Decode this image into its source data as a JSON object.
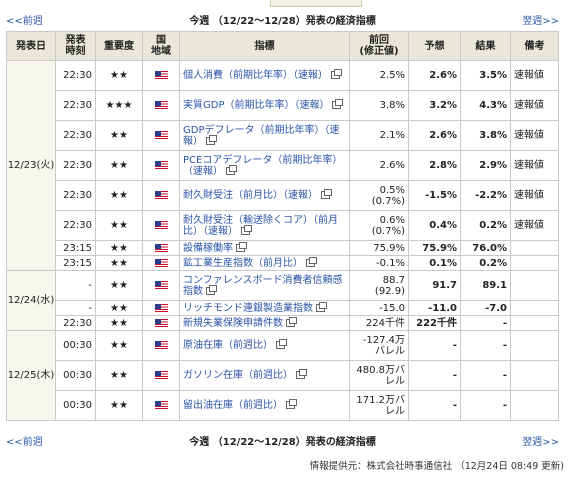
{
  "nav": {
    "prev": "<<前週",
    "title": "今週 （12/22～12/28）発表の経済指標",
    "next": "翌週>>"
  },
  "table": {
    "headers": [
      "発表日",
      "発表\n時刻",
      "重要度",
      "国\n地域",
      "指標",
      "前回\n(修正値)",
      "予想",
      "結果",
      "備考"
    ],
    "rows": [
      {
        "date": "12/23(火)",
        "time": "22:30",
        "importance": "★★",
        "indicator": "個人消費（前期比年率）（速報）",
        "previous": "2.5%",
        "forecast": "2.6%",
        "result": "3.5%",
        "note": "速報値"
      },
      {
        "time": "22:30",
        "importance": "★★★",
        "indicator": "実質GDP（前期比年率）（速報）",
        "previous": "3.8%",
        "forecast": "3.2%",
        "result": "4.3%",
        "note": "速報値"
      },
      {
        "time": "22:30",
        "importance": "★★",
        "indicator": "GDPデフレータ（前期比年率）（速報）",
        "previous": "2.1%",
        "forecast": "2.6%",
        "result": "3.8%",
        "note": "速報値"
      },
      {
        "time": "22:30",
        "importance": "★★",
        "indicator": "PCEコアデフレータ（前期比年率）（速報）",
        "previous": "2.6%",
        "forecast": "2.8%",
        "result": "2.9%",
        "note": "速報値"
      },
      {
        "time": "22:30",
        "importance": "★★",
        "indicator": "耐久財受注（前月比）（速報）",
        "previous": "0.5%\n(0.7%)",
        "forecast": "-1.5%",
        "result": "-2.2%",
        "note": "速報値"
      },
      {
        "time": "22:30",
        "importance": "★★",
        "indicator": "耐久財受注（輸送除くコア）（前月比）（速報）",
        "previous": "0.6%\n(0.7%)",
        "forecast": "0.4%",
        "result": "0.2%",
        "note": "速報値"
      },
      {
        "time": "23:15",
        "importance": "★★",
        "indicator": "設備稼働率",
        "previous": "75.9%",
        "forecast": "75.9%",
        "result": "76.0%",
        "note": ""
      },
      {
        "time": "23:15",
        "importance": "★★",
        "indicator": "鉱工業生産指数（前月比）",
        "previous": "-0.1%",
        "forecast": "0.1%",
        "result": "0.2%",
        "note": ""
      },
      {
        "date": "12/24(水)",
        "time": "-",
        "importance": "★★",
        "indicator": "コンファレンスボード消費者信頼感指数",
        "previous": "88.7\n(92.9)",
        "forecast": "91.7",
        "result": "89.1",
        "note": ""
      },
      {
        "time": "-",
        "importance": "★★",
        "indicator": "リッチモンド連銀製造業指数",
        "previous": "-15.0",
        "forecast": "-11.0",
        "result": "-7.0",
        "note": ""
      },
      {
        "time": "22:30",
        "importance": "★★",
        "indicator": "新規失業保険申請件数",
        "previous": "224千件",
        "forecast": "222千件",
        "result": "-",
        "note": ""
      },
      {
        "date": "12/25(木)",
        "time": "00:30",
        "importance": "★★",
        "indicator": "原油在庫（前週比）",
        "previous": "-127.4万バレル",
        "forecast": "-",
        "result": "-",
        "note": ""
      },
      {
        "time": "00:30",
        "importance": "★★",
        "indicator": "ガソリン在庫（前週比）",
        "previous": "480.8万バレル",
        "forecast": "-",
        "result": "-",
        "note": ""
      },
      {
        "time": "00:30",
        "importance": "★★",
        "indicator": "留出油在庫（前週比）",
        "previous": "171.2万バレル",
        "forecast": "-",
        "result": "-",
        "note": ""
      }
    ]
  },
  "footer": "情報提供元：株式会社時事通信社 （12月24日 08:49 更新)",
  "colors": {
    "link": "#2a54a8",
    "header_bg": "#e9e7d9",
    "border": "#c9c9c9",
    "flag_red": "#c8102e",
    "flag_blue": "#2b3d8f"
  },
  "icons": {
    "country": "us-flag-icon",
    "new_window": "external-window-icon"
  }
}
